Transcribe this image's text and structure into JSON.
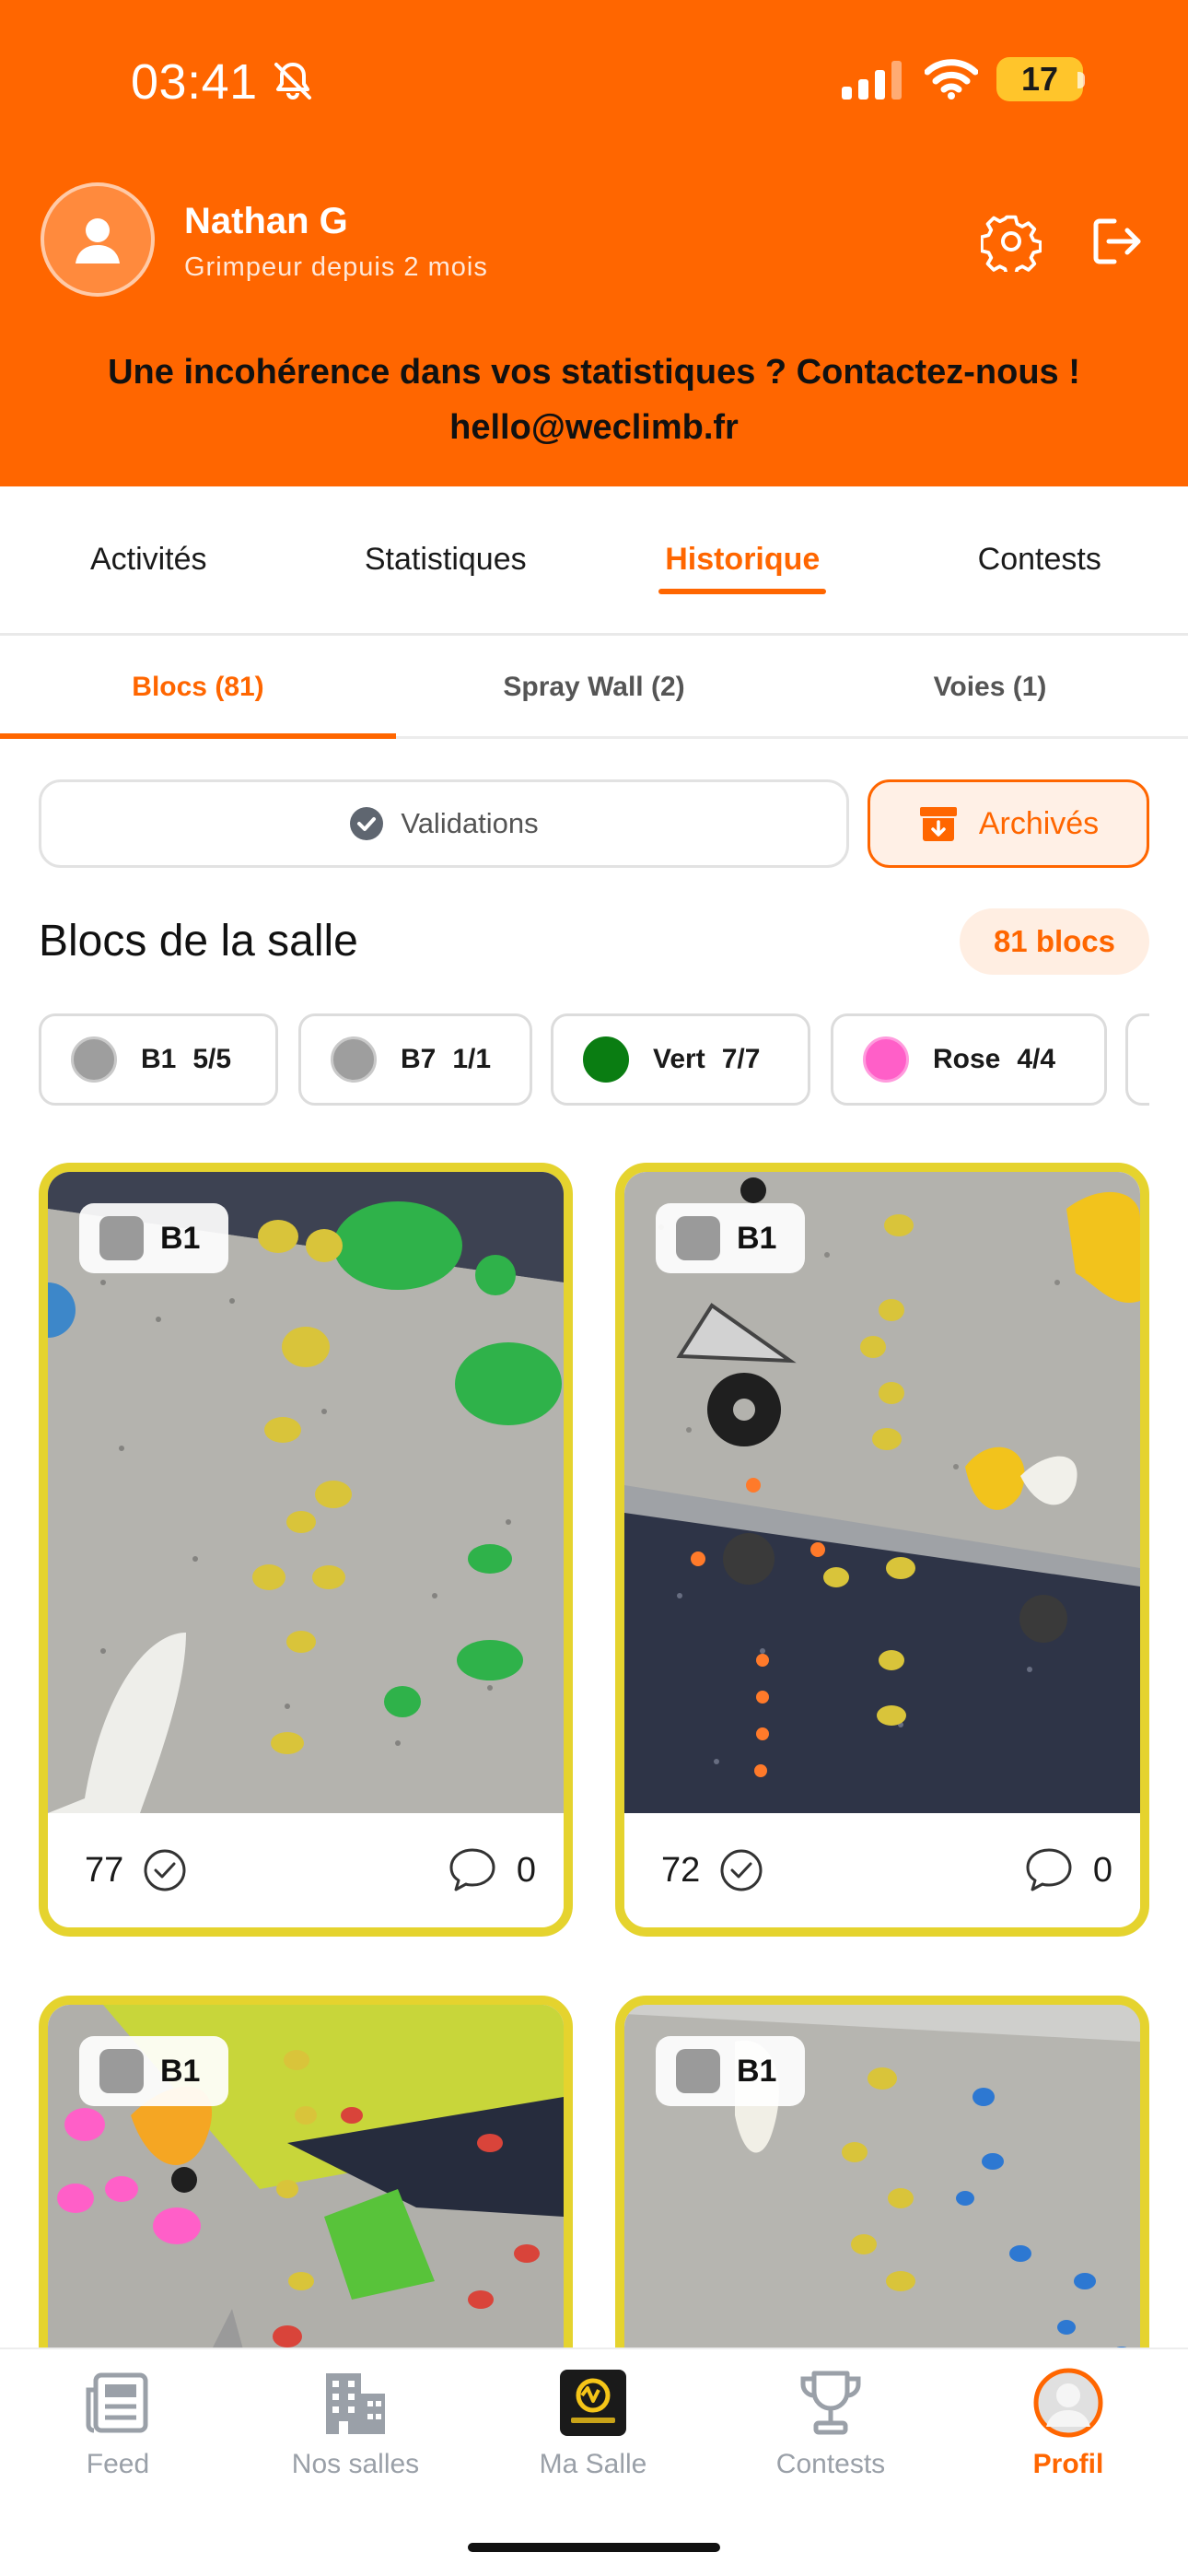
{
  "status_bar": {
    "time": "03:41",
    "battery": "17",
    "icons": [
      "bell-slash-icon",
      "signal-icon",
      "wifi-icon",
      "battery-icon"
    ]
  },
  "profile": {
    "name": "Nathan G",
    "subtitle": "Grimpeur depuis 2 mois",
    "notice_line1": "Une incohérence dans vos statistiques ? Contactez-nous !",
    "notice_line2": "hello@weclimb.fr"
  },
  "main_tabs": [
    {
      "label": "Activités",
      "active": false
    },
    {
      "label": "Statistiques",
      "active": false
    },
    {
      "label": "Historique",
      "active": true
    },
    {
      "label": "Contests",
      "active": false
    }
  ],
  "sub_tabs": [
    {
      "label": "Blocs (81)",
      "active": true
    },
    {
      "label": "Spray Wall (2)",
      "active": false
    },
    {
      "label": "Voies (1)",
      "active": false
    }
  ],
  "filters": {
    "validations_label": "Validations",
    "archives_label": "Archivés"
  },
  "section": {
    "title": "Blocs de la salle",
    "count": "81 blocs"
  },
  "grade_chips": [
    {
      "name": "B1",
      "count": "5/5",
      "color": "#9E9E9E"
    },
    {
      "name": "B7",
      "count": "1/1",
      "color": "#9E9E9E"
    },
    {
      "name": "Vert",
      "count": "7/7",
      "color": "#0A7D12"
    },
    {
      "name": "Rose",
      "count": "4/4",
      "color": "#FF5FC8"
    }
  ],
  "cards": [
    {
      "grade": "B1",
      "validations": "77",
      "comments": "0"
    },
    {
      "grade": "B1",
      "validations": "72",
      "comments": "0"
    },
    {
      "grade": "B1",
      "validations": "",
      "comments": ""
    },
    {
      "grade": "B1",
      "validations": "",
      "comments": ""
    }
  ],
  "bottom_nav": [
    {
      "label": "Feed",
      "icon": "newspaper-icon",
      "active": false
    },
    {
      "label": "Nos salles",
      "icon": "buildings-icon",
      "active": false
    },
    {
      "label": "Ma Salle",
      "icon": "gym-logo-icon",
      "active": false
    },
    {
      "label": "Contests",
      "icon": "trophy-icon",
      "active": false
    },
    {
      "label": "Profil",
      "icon": "profile-avatar-icon",
      "active": true
    }
  ],
  "colors": {
    "accent": "#FF6600",
    "card_border": "#E5D32E",
    "battery": "#FFC52B"
  }
}
